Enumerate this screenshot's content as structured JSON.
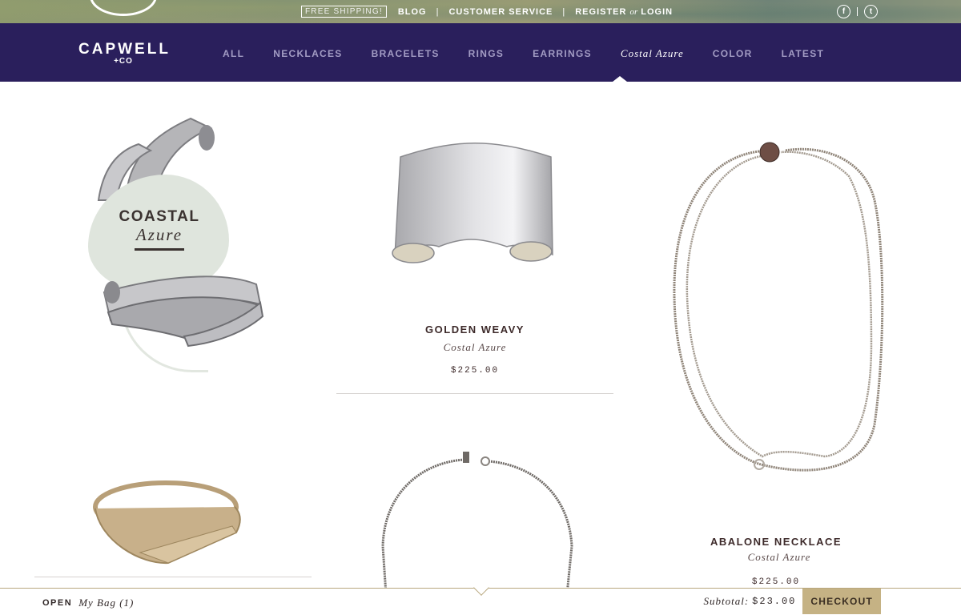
{
  "topbar": {
    "free_shipping": "FREE SHIPPING!",
    "blog": "BLOG",
    "customer_service": "CUSTOMER SERVICE",
    "register": "REGISTER",
    "or": "or",
    "login": "LOGIN",
    "separator": "|",
    "social": [
      {
        "icon": "facebook-icon",
        "glyph": "f"
      },
      {
        "icon": "twitter-icon",
        "glyph": "t"
      }
    ]
  },
  "brand": {
    "name": "CAPWELL",
    "sub": "+CO"
  },
  "nav": {
    "items": [
      "ALL",
      "NECKLACES",
      "BRACELETS",
      "RINGS",
      "EARRINGS",
      "Costal Azure",
      "COLOR",
      "LATEST"
    ],
    "active": "Costal Azure"
  },
  "feature": {
    "title": "COASTAL",
    "subtitle": "Azure"
  },
  "products": [
    {
      "name": "GOLDEN WEAVY",
      "collection": "Costal Azure",
      "price": "$225.00"
    },
    {
      "name": "ABALONE NECKLACE",
      "collection": "Costal Azure",
      "price": "$225.00"
    }
  ],
  "bag": {
    "open": "OPEN",
    "label": "My Bag (1)",
    "subtotal_label": "Subtotal:",
    "subtotal_value": "$23.00",
    "checkout": "CHECKOUT"
  },
  "colors": {
    "nav_bg": "#2a1f5c",
    "nav_link": "#a39cc4",
    "accent_gold": "#c5b284",
    "blob": "#dfe5dd"
  }
}
